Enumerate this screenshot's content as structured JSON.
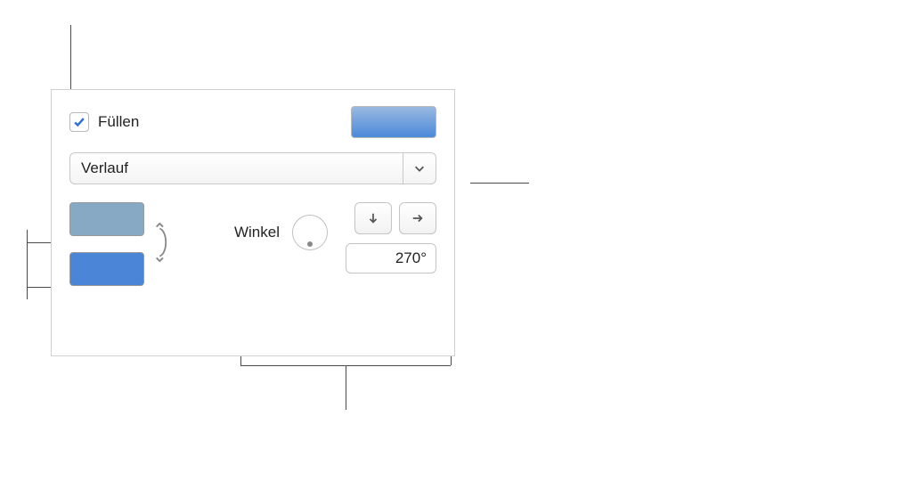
{
  "fill": {
    "label": "Füllen",
    "checked": true,
    "preview_gradient": [
      "#99b9e0",
      "#4b89db"
    ]
  },
  "fillType": {
    "selected": "Verlauf"
  },
  "gradient": {
    "stops": [
      "#88a9c4",
      "#4a85d8"
    ],
    "angle": {
      "label": "Winkel",
      "value": "270°"
    }
  }
}
